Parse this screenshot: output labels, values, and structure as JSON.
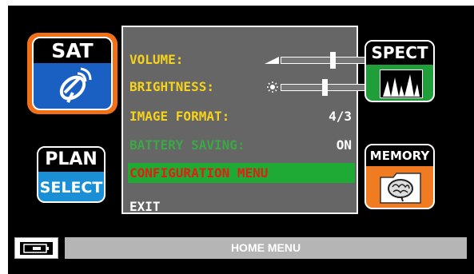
{
  "icons": {
    "sat": {
      "label": "SAT"
    },
    "plan": {
      "top_label": "PLAN",
      "bottom_label": "SELECT"
    },
    "spect": {
      "label": "SPECT"
    },
    "memory": {
      "label": "MEMORY"
    }
  },
  "menu": {
    "volume": {
      "label": "VOLUME:",
      "level": 0.62
    },
    "brightness": {
      "label": "BRIGHTNESS:",
      "level": 0.52
    },
    "image_format": {
      "label": "IMAGE FORMAT:",
      "value": "4/3"
    },
    "battery_saving": {
      "label": "BATTERY SAVING:",
      "value": "ON"
    },
    "configuration": {
      "label": "CONFIGURATION MENU"
    },
    "exit": {
      "label": "EXIT"
    }
  },
  "footer": {
    "title": "HOME MENU"
  },
  "colors": {
    "accent_orange": "#f07018",
    "sat_blue": "#1a5fc2",
    "select_green": "#1faa36",
    "menu_yellow": "#f5d21c"
  }
}
